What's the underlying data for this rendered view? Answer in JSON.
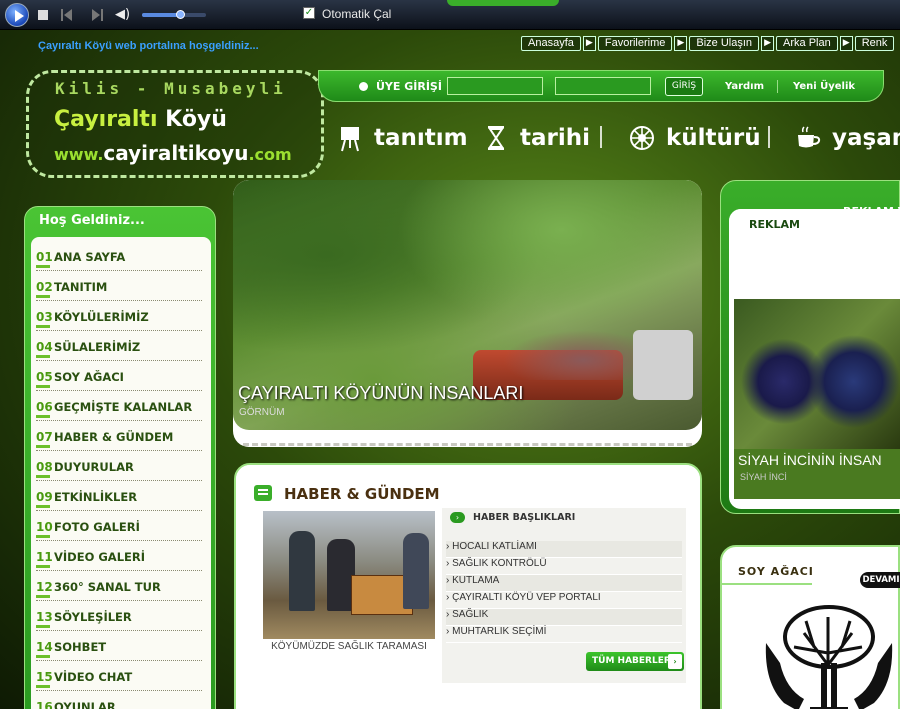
{
  "player": {
    "autoplay_checked": true,
    "autoplay_check_glyph": "✓",
    "autoplay_label": "Otomatik Çal",
    "volume": 0.6,
    "volume_glyph": "◀)"
  },
  "welcome_text": "Çayıraltı Köyü web portalına hoşgeldiniz...",
  "top_links": [
    {
      "label": "Anasayfa"
    },
    {
      "label": "Favorilerime"
    },
    {
      "label": "Bize Ulaşın"
    },
    {
      "label": "Arka Plan"
    },
    {
      "label": "Renk"
    }
  ],
  "top_link_arrow": "▶",
  "logo": {
    "line1": "Kilis - Musabeyli",
    "line2_a": "Çayıraltı ",
    "line2_b": "Köyü",
    "line3_a": "www.",
    "line3_b": "cayiraltikoyu",
    "line3_c": ".com"
  },
  "login": {
    "title": "ÜYE GİRİŞİ",
    "user_value": "",
    "pass_value": "",
    "button": "GİRİŞ",
    "help": "Yardım",
    "register": "Yeni Üyelik"
  },
  "main_nav": [
    {
      "label": "tanıtım",
      "icon": "easel-icon"
    },
    {
      "label": "tarihi",
      "icon": "hourglass-icon"
    },
    {
      "label": "kültürü",
      "icon": "ornament-icon"
    },
    {
      "label": "yaşamı",
      "icon": "coffee-icon"
    }
  ],
  "sidebar": {
    "title": "Hoş Geldiniz...",
    "items": [
      {
        "num": "01",
        "label": "ANA SAYFA"
      },
      {
        "num": "02",
        "label": "TANITIM"
      },
      {
        "num": "03",
        "label": "KÖYLÜLERİMİZ"
      },
      {
        "num": "04",
        "label": "SÜLALERİMİZ"
      },
      {
        "num": "05",
        "label": "SOY AĞACI"
      },
      {
        "num": "06",
        "label": "GEÇMİŞTE KALANLAR"
      },
      {
        "num": "07",
        "label": "HABER & GÜNDEM"
      },
      {
        "num": "08",
        "label": "DUYURULAR"
      },
      {
        "num": "09",
        "label": "ETKİNLİKLER"
      },
      {
        "num": "10",
        "label": "FOTO GALERİ"
      },
      {
        "num": "11",
        "label": "VİDEO GALERİ"
      },
      {
        "num": "12",
        "label": "360° SANAL TUR"
      },
      {
        "num": "13",
        "label": "SÖYLEŞİLER"
      },
      {
        "num": "14",
        "label": "SOHBET"
      },
      {
        "num": "15",
        "label": "VİDEO CHAT"
      },
      {
        "num": "16",
        "label": "OYUNLAR"
      }
    ]
  },
  "slideshow": {
    "title": "ÇAYIRALTI KÖYÜNÜN İNSANLARI",
    "subtitle": "GÖRNÜM"
  },
  "news": {
    "title": "HABER & GÜNDEM",
    "photo_caption": "KÖYÜMÜZDE SAĞLIK TARAMASI",
    "headlines_title": "HABER BAŞLIKLARI",
    "headlines_arrow": "›",
    "headlines": [
      "› HOCALI KATLİAMI",
      "› SAĞLIK KONTRÖLÜ",
      "› KUTLAMA",
      "› ÇAYIRALTI KÖYÜ VEP PORTALI",
      "› SAĞLIK",
      "› MUHTARLIK SEÇİMİ"
    ],
    "all_button": "TÜM HABERLER",
    "all_button_arrow": "›"
  },
  "reklam": {
    "tab_title": "REKLAM",
    "second_tab": "REKLAM V",
    "caption_title": "SİYAH İNCİNİN İNSAN",
    "caption_sub": "SİYAH İNCİ"
  },
  "soy": {
    "title": "SOY AĞACI",
    "more": "DEVAMI"
  }
}
